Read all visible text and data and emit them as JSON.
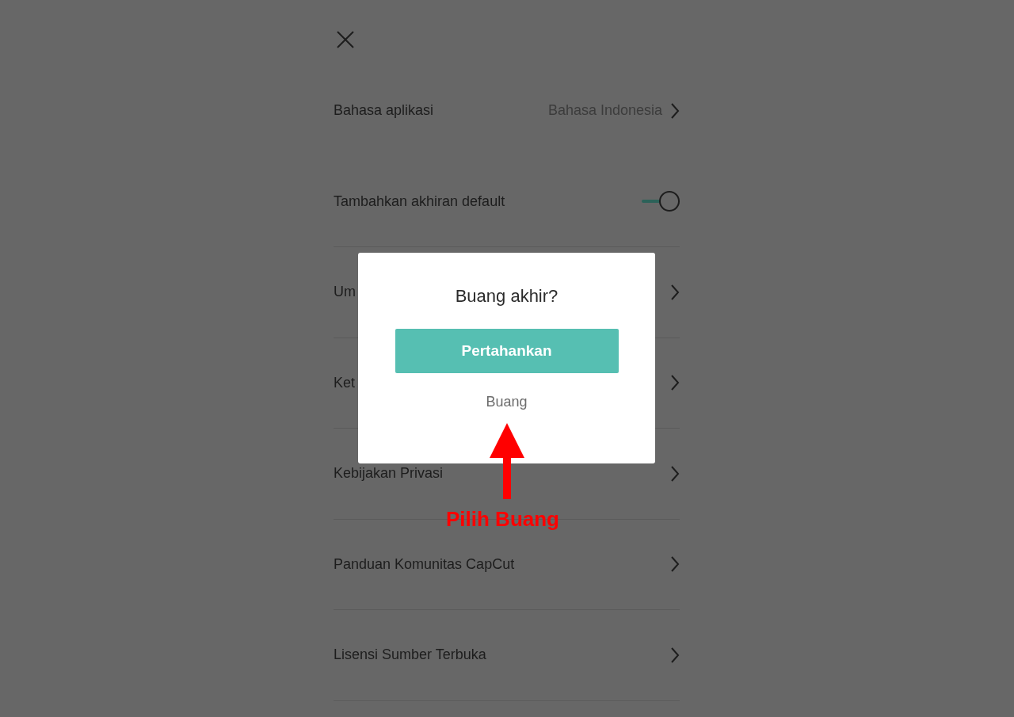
{
  "settings": {
    "rows": [
      {
        "kind": "link",
        "label": "Bahasa aplikasi",
        "value": "Bahasa Indonesia"
      },
      {
        "kind": "toggle",
        "label": "Tambahkan akhiran default",
        "on": true
      },
      {
        "kind": "link",
        "label": "Um"
      },
      {
        "kind": "link",
        "label": "Ket"
      },
      {
        "kind": "link",
        "label": "Kebijakan Privasi"
      },
      {
        "kind": "link",
        "label": "Panduan Komunitas CapCut"
      },
      {
        "kind": "link",
        "label": "Lisensi Sumber Terbuka"
      }
    ]
  },
  "dialog": {
    "title": "Buang akhir?",
    "primary": "Pertahankan",
    "secondary": "Buang"
  },
  "annotation": {
    "label": "Pilih Buang"
  }
}
